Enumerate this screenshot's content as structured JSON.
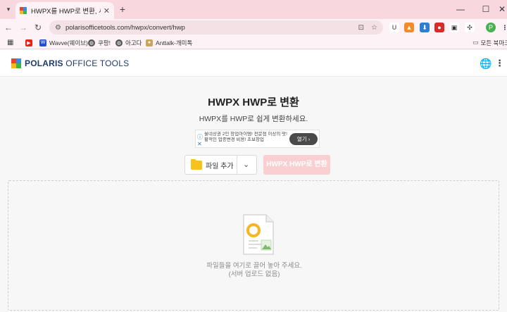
{
  "browser": {
    "tab_title": "HWPX를 HWP로 변환, 서버에",
    "url": "polarisofficetools.com/hwpx/convert/hwp",
    "profile_initial": "P",
    "bookmarks": [
      {
        "label": "Wavve(웨이브)"
      },
      {
        "label": "쿠팡!"
      },
      {
        "label": "아고다"
      },
      {
        "label": "Anttalk-개미톡"
      }
    ],
    "all_bookmarks_label": "모든 북마크"
  },
  "site": {
    "logo_brand": "POLARIS",
    "logo_suffix": "OFFICE TOOLS"
  },
  "page": {
    "title": "HWPX HWP로 변환",
    "subtitle": "HWPX를 HWP로 쉽게 변환하세요."
  },
  "ad": {
    "text": "울네상권 2인 창업아이템! 전문점 이상의 맛! 황적인 업종변경 비용! 초보창업",
    "button": "열기"
  },
  "controls": {
    "add_file_label": "파일 추가",
    "convert_label": "HWPX HWP로 변환"
  },
  "dropzone": {
    "text": "파일들을 여기로 끌어 놓아 주세요.",
    "sub": "(서버 업로드 없음)"
  },
  "colors": {
    "tabstrip": "#f9d7df",
    "convert_disabled": "#f9cfd2",
    "logo_blue": "#1e3a6e",
    "folder": "#f7c21a"
  }
}
